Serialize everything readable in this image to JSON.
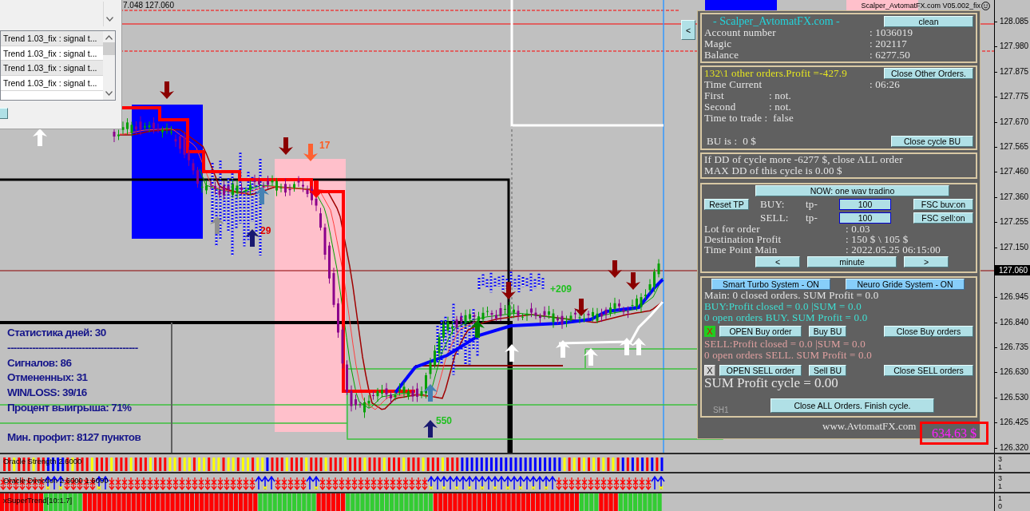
{
  "chart": {
    "quote": "7.048 127.060",
    "title": "Scalper_AvtomatFX.com V05.002_fix",
    "labels": [
      {
        "text": "17",
        "color": "#ff5a1e"
      },
      {
        "text": "29",
        "color": "#e00000"
      },
      {
        "text": "+209",
        "color": "#20c020"
      },
      {
        "text": "550",
        "color": "#20c020"
      },
      {
        "text": "SH1",
        "color": "#a8a8a8"
      }
    ]
  },
  "dialog": {
    "list_items": [
      "Trend 1.03_fix : signal t...",
      "Trend 1.03_fix : signal t...",
      "Trend 1.03_fix : signal t...",
      "Trend 1.03_fix : signal t..."
    ]
  },
  "stats": {
    "lines": [
      "Статистика дней: 30",
      "------------------------------------------",
      "Сигналов: 86",
      "Отмененных: 31",
      "WIN/LOSS: 39/16",
      "Процент выигрыша: 71%",
      "Мин. профит: 8127 пунктов"
    ]
  },
  "panel": {
    "collapse_button": "<",
    "header": {
      "title": "- Scalper_AvtomatFX.com -",
      "button": "clean",
      "fields": [
        {
          "label": "Account number",
          "value": ": 1036019"
        },
        {
          "label": "Magic",
          "value": ": 202117"
        },
        {
          "label": "Balance",
          "value": ": 6277.50"
        }
      ]
    },
    "orders": {
      "summary": "132\\1 other orders.Profit =-427.9",
      "button": "Close Other Orders.",
      "fields": [
        {
          "label": "Time Current",
          "value": ": 06:26"
        }
      ],
      "checks": [
        {
          "label": "First",
          "value": ": not."
        },
        {
          "label": "Second",
          "value": ": not."
        }
      ],
      "trade_line": "Time to trade :  false",
      "bu_line": "BU is :  0 $",
      "bu_button": "Close cycle BU"
    },
    "drawdown": {
      "lines": [
        "If DD of cycle more -6277 $, close ALL order",
        "MAX DD of this cycle is 0.00 $"
      ]
    },
    "trading": {
      "mode_button": "NOW: one wav tradino",
      "reset_button": "Reset TP",
      "tp_rows": [
        {
          "side": "BUY:",
          "prefix": "tp-",
          "value": "100",
          "button": "FSC buv:on"
        },
        {
          "side": "SELL:",
          "prefix": "tp-",
          "value": "100",
          "button": "FSC sell:on"
        }
      ],
      "fields": [
        {
          "label": "Lot for order",
          "value": ": 0.03"
        },
        {
          "label": "Destination Profit",
          "value": ": 150 $ \\ 105 $"
        },
        {
          "label": "Time Point Main",
          "value": ": 2022.05.25 06:15:00"
        }
      ],
      "nav_buttons": [
        "<",
        "minute",
        ">"
      ]
    },
    "systems": {
      "buttons": [
        "Smart Turbo System - ON",
        "Neuro Gride System - ON"
      ],
      "main_line": "Main: 0 closed orders. SUM Profit = 0.0",
      "sides": [
        {
          "kind": "buy",
          "lines": [
            "BUY:Profit closed = 0.0 |SUM = 0.0",
            "0 open orders BUY. SUM Profit = 0.0"
          ],
          "toggle": {
            "label": "X",
            "active": true
          },
          "buttons": [
            "OPEN Buy order",
            "Buy BU",
            "Close Buy orders"
          ]
        },
        {
          "kind": "sell",
          "lines": [
            "SELL:Profit closed = 0.0 |SUM = 0.0",
            "0 open orders SELL. SUM Profit = 0.0"
          ],
          "toggle": {
            "label": "X",
            "active": false
          },
          "buttons": [
            "OPEN SELL order",
            "Sell BU",
            "Close SELL orders"
          ]
        }
      ],
      "sum_line": "SUM Profit cycle = 0.00",
      "close_all_button": "Close ALL Orders. Finish cycle."
    },
    "footer": "www.AvtomatFX.com",
    "profit": "634.63 $"
  },
  "price_axis": {
    "ticks": [
      "128.085",
      "127.980",
      "127.875",
      "127.775",
      "127.670",
      "127.565",
      "127.460",
      "127.360",
      "127.255",
      "127.150",
      "126.945",
      "126.840",
      "126.735",
      "126.630",
      "126.530",
      "126.425",
      "126.320"
    ],
    "current_price": "127.060"
  },
  "indicators": [
    {
      "kind": "histogram",
      "label": "Oracle Strength 2.6000",
      "scale": [
        "3",
        "1"
      ]
    },
    {
      "kind": "arrows",
      "label": "Oracle Direction 2.6000 1.6000",
      "scale": [
        "3",
        "1"
      ]
    },
    {
      "kind": "trend",
      "label": "xSuperTrend[10:1.7]",
      "scale": [
        "1",
        "0"
      ]
    }
  ]
}
